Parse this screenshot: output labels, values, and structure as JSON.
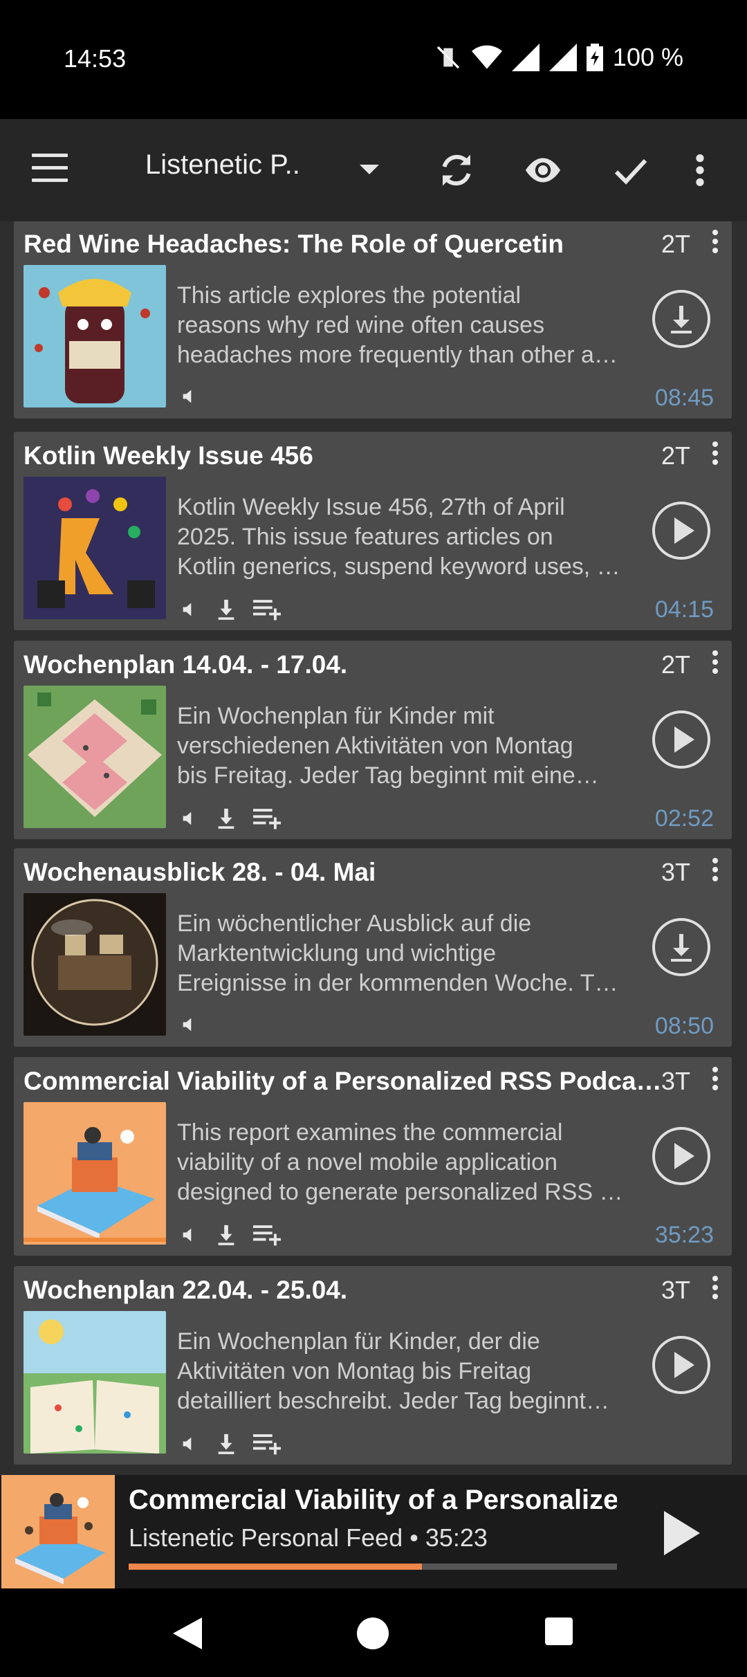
{
  "status": {
    "time": "14:53",
    "battery": "100 %"
  },
  "toolbar": {
    "title": "Listenetic P..",
    "icons": [
      "menu-icon",
      "dropdown-icon",
      "refresh-icon",
      "eye-icon",
      "check-icon",
      "overflow-icon"
    ]
  },
  "episodes": [
    {
      "title": "Red Wine Headaches: The Role of Quercetin",
      "age": "2T",
      "desc": [
        "This article explores the potential",
        "reasons why red wine often causes",
        "headaches more frequently than other a…"
      ],
      "duration": "08:45",
      "action": "download",
      "icons": [
        "speaker-icon"
      ]
    },
    {
      "title": "Kotlin Weekly Issue 456",
      "age": "2T",
      "desc": [
        "Kotlin Weekly Issue 456, 27th of April",
        "2025. This issue features articles on",
        "Kotlin generics, suspend keyword uses, …"
      ],
      "duration": "04:15",
      "action": "play",
      "icons": [
        "speaker-icon",
        "downloaded-icon",
        "playlist-icon"
      ]
    },
    {
      "title": "Wochenplan 14.04. - 17.04.",
      "age": "2T",
      "desc": [
        "Ein Wochenplan für Kinder mit",
        "verschiedenen Aktivitäten von Montag",
        "bis Freitag. Jeder Tag beginnt mit eine…"
      ],
      "duration": "02:52",
      "action": "play",
      "icons": [
        "speaker-icon",
        "downloaded-icon",
        "playlist-icon"
      ]
    },
    {
      "title": "Wochenausblick 28. - 04. Mai",
      "age": "3T",
      "desc": [
        "Ein wöchentlicher Ausblick auf die",
        "Marktentwicklung und wichtige",
        "Ereignisse in der kommenden Woche. T…"
      ],
      "duration": "08:50",
      "action": "download",
      "icons": [
        "speaker-icon"
      ]
    },
    {
      "title": "Commercial Viability of a Personalized RSS Podca…",
      "age": "3T",
      "desc": [
        "This report examines the commercial",
        "viability of a novel mobile application",
        "designed to generate personalized RSS …"
      ],
      "duration": "35:23",
      "action": "play",
      "icons": [
        "speaker-icon",
        "downloaded-icon",
        "playlist-icon"
      ]
    },
    {
      "title": "Wochenplan 22.04. - 25.04.",
      "age": "3T",
      "desc": [
        "Ein Wochenplan für Kinder, der die",
        "Aktivitäten von Montag bis Freitag",
        "detailliert beschreibt. Jeder Tag beginnt…"
      ],
      "duration": "",
      "action": "play",
      "icons": [
        "speaker-icon",
        "downloaded-icon",
        "playlist-icon"
      ]
    }
  ],
  "player": {
    "title": "Commercial Viability of a Personalize",
    "subtitle": "Listenetic Personal Feed • 35:23",
    "progress": 0.6,
    "accent": "#f0874a"
  },
  "colors": {
    "duration": "#6f9bc2",
    "card": "#4b4b4b",
    "toolbar": "#262626"
  }
}
